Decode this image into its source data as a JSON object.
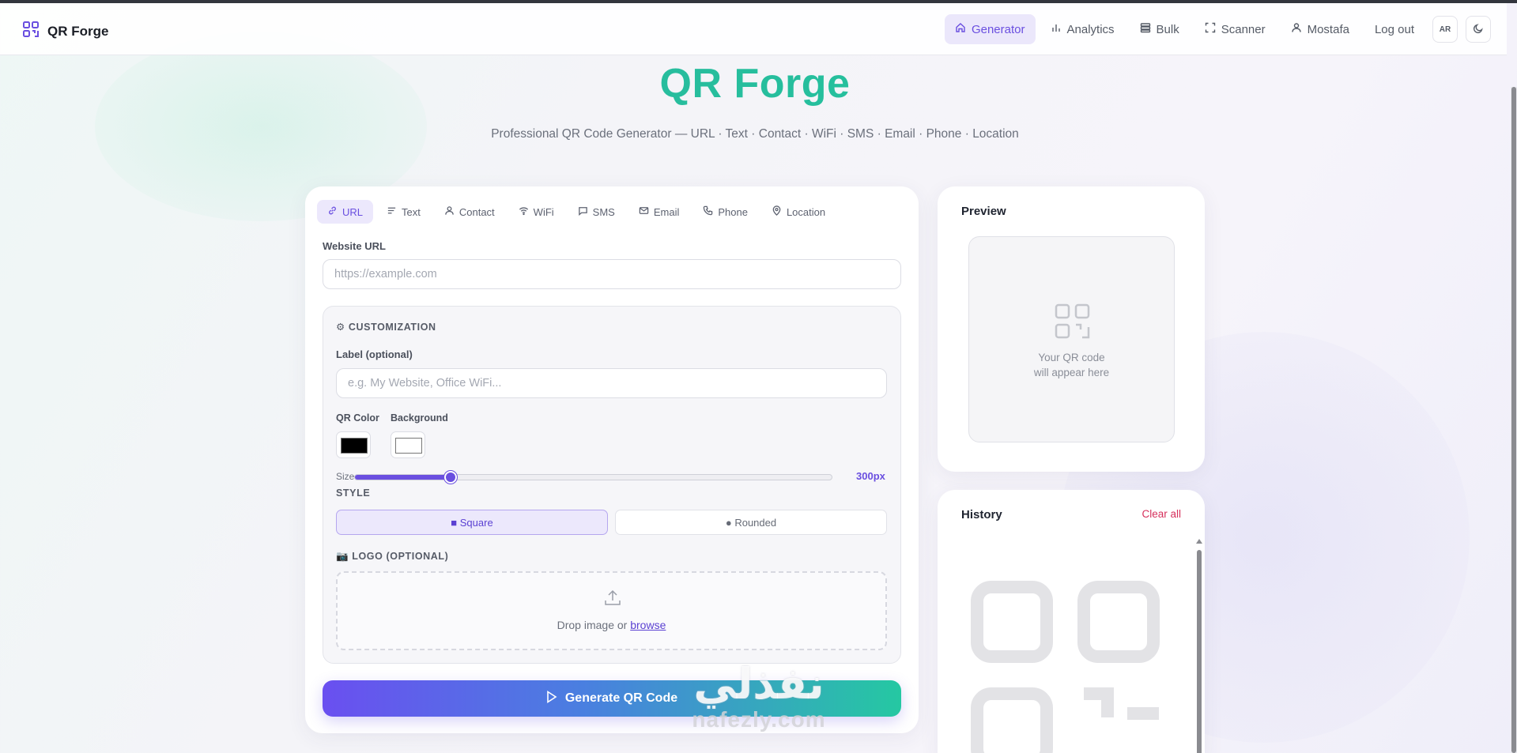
{
  "nav": {
    "brand": "QR Forge",
    "items": [
      {
        "label": "Generator",
        "icon": "home-icon",
        "active": true
      },
      {
        "label": "Analytics",
        "icon": "bar-chart-icon",
        "active": false
      },
      {
        "label": "Bulk",
        "icon": "stack-icon",
        "active": false
      },
      {
        "label": "Scanner",
        "icon": "scan-icon",
        "active": false
      },
      {
        "label": "Mostafa",
        "icon": "user-icon",
        "active": false
      },
      {
        "label": "Log out",
        "icon": "",
        "active": false
      }
    ],
    "lang_button": "AR",
    "theme_icon": "moon-icon"
  },
  "hero": {
    "title": "QR Forge",
    "subtitle": "Professional QR Code Generator — URL · Text · Contact · WiFi · SMS · Email · Phone · Location"
  },
  "tabs": [
    {
      "label": "URL",
      "icon": "link-icon",
      "active": true
    },
    {
      "label": "Text",
      "icon": "text-icon",
      "active": false
    },
    {
      "label": "Contact",
      "icon": "user-icon",
      "active": false
    },
    {
      "label": "WiFi",
      "icon": "wifi-icon",
      "active": false
    },
    {
      "label": "SMS",
      "icon": "message-icon",
      "active": false
    },
    {
      "label": "Email",
      "icon": "mail-icon",
      "active": false
    },
    {
      "label": "Phone",
      "icon": "phone-icon",
      "active": false
    },
    {
      "label": "Location",
      "icon": "pin-icon",
      "active": false
    }
  ],
  "url_field": {
    "label": "Website URL",
    "value": "",
    "placeholder": "https://example.com"
  },
  "customization": {
    "title": "⚙ CUSTOMIZATION",
    "label_field": {
      "label": "Label (optional)",
      "value": "",
      "placeholder": "e.g. My Website, Office WiFi..."
    },
    "qr_color_label": "QR Color",
    "qr_color": "#000000",
    "background_label": "Background",
    "background_color": "#ffffff",
    "size_label": "Size",
    "size_value": "300px",
    "size_fraction": 0.2,
    "style_title": "STYLE",
    "style_options": [
      {
        "label": "■ Square",
        "active": true
      },
      {
        "label": "● Rounded",
        "active": false
      }
    ],
    "logo_title": "📷 LOGO (OPTIONAL)",
    "drop_text": "Drop image or",
    "browse_link": "browse"
  },
  "generate_button": "Generate QR Code",
  "preview": {
    "title": "Preview",
    "placeholder_line1": "Your QR code",
    "placeholder_line2": "will appear here"
  },
  "history": {
    "title": "History",
    "clear_label": "Clear all"
  },
  "watermark": {
    "arabic": "نفذلي",
    "latin": "nafezly.com"
  },
  "colors": {
    "accent": "#6a4fe0",
    "teal": "#22c79a",
    "danger": "#d6305c"
  }
}
